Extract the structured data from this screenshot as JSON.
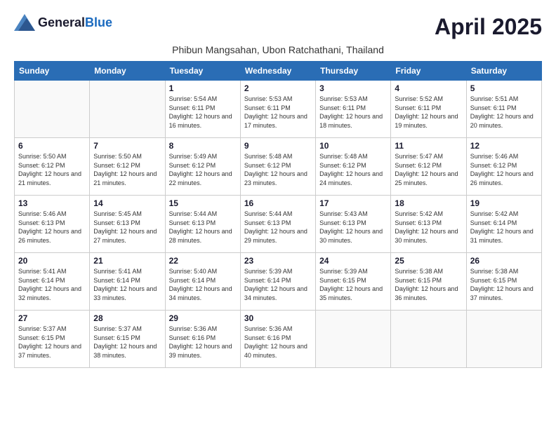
{
  "header": {
    "logo_general": "General",
    "logo_blue": "Blue",
    "title": "April 2025",
    "subtitle": "Phibun Mangsahan, Ubon Ratchathani, Thailand"
  },
  "days_of_week": [
    "Sunday",
    "Monday",
    "Tuesday",
    "Wednesday",
    "Thursday",
    "Friday",
    "Saturday"
  ],
  "weeks": [
    [
      {
        "day": "",
        "info": ""
      },
      {
        "day": "",
        "info": ""
      },
      {
        "day": "1",
        "info": "Sunrise: 5:54 AM\nSunset: 6:11 PM\nDaylight: 12 hours and 16 minutes."
      },
      {
        "day": "2",
        "info": "Sunrise: 5:53 AM\nSunset: 6:11 PM\nDaylight: 12 hours and 17 minutes."
      },
      {
        "day": "3",
        "info": "Sunrise: 5:53 AM\nSunset: 6:11 PM\nDaylight: 12 hours and 18 minutes."
      },
      {
        "day": "4",
        "info": "Sunrise: 5:52 AM\nSunset: 6:11 PM\nDaylight: 12 hours and 19 minutes."
      },
      {
        "day": "5",
        "info": "Sunrise: 5:51 AM\nSunset: 6:11 PM\nDaylight: 12 hours and 20 minutes."
      }
    ],
    [
      {
        "day": "6",
        "info": "Sunrise: 5:50 AM\nSunset: 6:12 PM\nDaylight: 12 hours and 21 minutes."
      },
      {
        "day": "7",
        "info": "Sunrise: 5:50 AM\nSunset: 6:12 PM\nDaylight: 12 hours and 21 minutes."
      },
      {
        "day": "8",
        "info": "Sunrise: 5:49 AM\nSunset: 6:12 PM\nDaylight: 12 hours and 22 minutes."
      },
      {
        "day": "9",
        "info": "Sunrise: 5:48 AM\nSunset: 6:12 PM\nDaylight: 12 hours and 23 minutes."
      },
      {
        "day": "10",
        "info": "Sunrise: 5:48 AM\nSunset: 6:12 PM\nDaylight: 12 hours and 24 minutes."
      },
      {
        "day": "11",
        "info": "Sunrise: 5:47 AM\nSunset: 6:12 PM\nDaylight: 12 hours and 25 minutes."
      },
      {
        "day": "12",
        "info": "Sunrise: 5:46 AM\nSunset: 6:12 PM\nDaylight: 12 hours and 26 minutes."
      }
    ],
    [
      {
        "day": "13",
        "info": "Sunrise: 5:46 AM\nSunset: 6:13 PM\nDaylight: 12 hours and 26 minutes."
      },
      {
        "day": "14",
        "info": "Sunrise: 5:45 AM\nSunset: 6:13 PM\nDaylight: 12 hours and 27 minutes."
      },
      {
        "day": "15",
        "info": "Sunrise: 5:44 AM\nSunset: 6:13 PM\nDaylight: 12 hours and 28 minutes."
      },
      {
        "day": "16",
        "info": "Sunrise: 5:44 AM\nSunset: 6:13 PM\nDaylight: 12 hours and 29 minutes."
      },
      {
        "day": "17",
        "info": "Sunrise: 5:43 AM\nSunset: 6:13 PM\nDaylight: 12 hours and 30 minutes."
      },
      {
        "day": "18",
        "info": "Sunrise: 5:42 AM\nSunset: 6:13 PM\nDaylight: 12 hours and 30 minutes."
      },
      {
        "day": "19",
        "info": "Sunrise: 5:42 AM\nSunset: 6:14 PM\nDaylight: 12 hours and 31 minutes."
      }
    ],
    [
      {
        "day": "20",
        "info": "Sunrise: 5:41 AM\nSunset: 6:14 PM\nDaylight: 12 hours and 32 minutes."
      },
      {
        "day": "21",
        "info": "Sunrise: 5:41 AM\nSunset: 6:14 PM\nDaylight: 12 hours and 33 minutes."
      },
      {
        "day": "22",
        "info": "Sunrise: 5:40 AM\nSunset: 6:14 PM\nDaylight: 12 hours and 34 minutes."
      },
      {
        "day": "23",
        "info": "Sunrise: 5:39 AM\nSunset: 6:14 PM\nDaylight: 12 hours and 34 minutes."
      },
      {
        "day": "24",
        "info": "Sunrise: 5:39 AM\nSunset: 6:15 PM\nDaylight: 12 hours and 35 minutes."
      },
      {
        "day": "25",
        "info": "Sunrise: 5:38 AM\nSunset: 6:15 PM\nDaylight: 12 hours and 36 minutes."
      },
      {
        "day": "26",
        "info": "Sunrise: 5:38 AM\nSunset: 6:15 PM\nDaylight: 12 hours and 37 minutes."
      }
    ],
    [
      {
        "day": "27",
        "info": "Sunrise: 5:37 AM\nSunset: 6:15 PM\nDaylight: 12 hours and 37 minutes."
      },
      {
        "day": "28",
        "info": "Sunrise: 5:37 AM\nSunset: 6:15 PM\nDaylight: 12 hours and 38 minutes."
      },
      {
        "day": "29",
        "info": "Sunrise: 5:36 AM\nSunset: 6:16 PM\nDaylight: 12 hours and 39 minutes."
      },
      {
        "day": "30",
        "info": "Sunrise: 5:36 AM\nSunset: 6:16 PM\nDaylight: 12 hours and 40 minutes."
      },
      {
        "day": "",
        "info": ""
      },
      {
        "day": "",
        "info": ""
      },
      {
        "day": "",
        "info": ""
      }
    ]
  ]
}
